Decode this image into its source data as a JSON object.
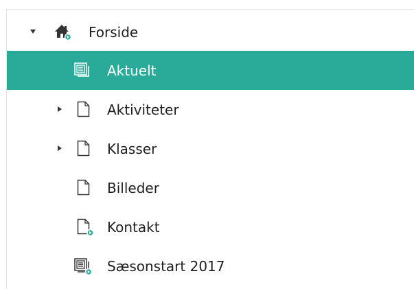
{
  "tree": {
    "items": [
      {
        "label": "Forside",
        "icon": "home-published-icon",
        "expanded": true,
        "has_children": true,
        "selected": false
      },
      {
        "label": "Aktuelt",
        "icon": "list-page-icon",
        "has_children": false,
        "selected": true
      },
      {
        "label": "Aktiviteter",
        "icon": "page-icon",
        "expanded": false,
        "has_children": true,
        "selected": false
      },
      {
        "label": "Klasser",
        "icon": "page-icon",
        "expanded": false,
        "has_children": true,
        "selected": false
      },
      {
        "label": "Billeder",
        "icon": "page-icon",
        "has_children": false,
        "selected": false
      },
      {
        "label": "Kontakt",
        "icon": "page-published-icon",
        "has_children": false,
        "selected": false
      },
      {
        "label": "Sæsonstart 2017",
        "icon": "list-page-published-icon",
        "has_children": false,
        "selected": false
      }
    ]
  },
  "colors": {
    "selected_background": "#2aaa99",
    "selected_text": "#ffffff",
    "published_dot": "#2aaa99",
    "text": "#1e1e1e",
    "icon_stroke": "#333333"
  }
}
